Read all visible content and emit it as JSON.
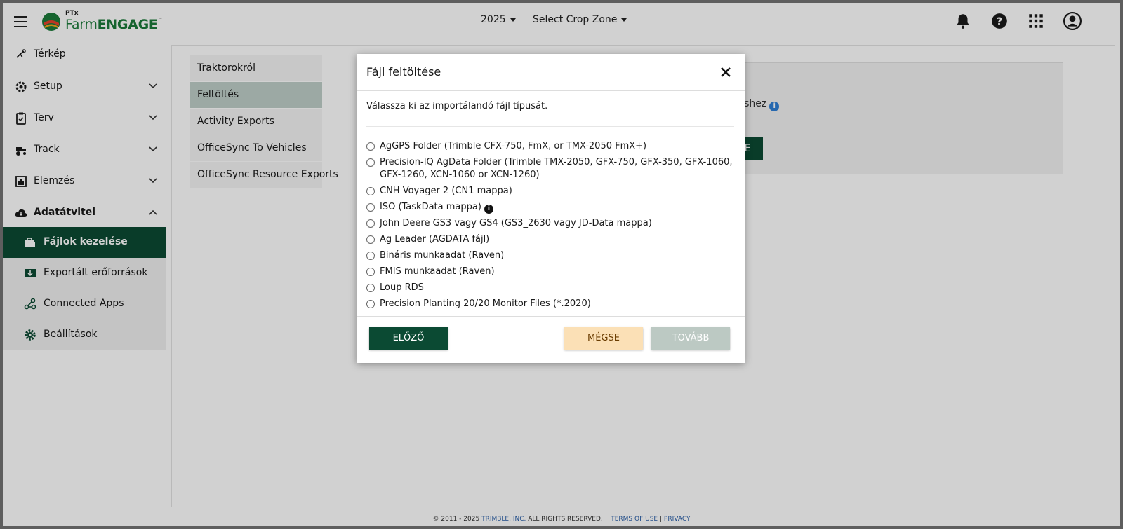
{
  "topbar": {
    "logo_ptx": "PTx",
    "logo_farm": "Farm",
    "logo_engage": "ENGAGE",
    "logo_tm": "™",
    "year": "2025",
    "crop_zone": "Select Crop Zone",
    "icons": [
      "bell-icon",
      "help-icon",
      "apps-grid-icon",
      "account-icon"
    ]
  },
  "sidebar": {
    "items": [
      {
        "label": "Térkép",
        "icon": "map-pin-icon"
      },
      {
        "label": "Setup",
        "icon": "gear-setup-icon"
      },
      {
        "label": "Terv",
        "icon": "clipboard-icon"
      },
      {
        "label": "Track",
        "icon": "tractor-icon"
      },
      {
        "label": "Elemzés",
        "icon": "analytics-icon"
      },
      {
        "label": "Adatátvitel",
        "icon": "cloud-download-icon"
      }
    ],
    "subitems": [
      {
        "label": "Fájlok kezelése",
        "icon": "files-icon"
      },
      {
        "label": "Exportált erőforrások",
        "icon": "export-icon"
      },
      {
        "label": "Connected Apps",
        "icon": "share-nodes-icon"
      },
      {
        "label": "Beállítások",
        "icon": "settings-icon"
      }
    ]
  },
  "content": {
    "tabs": [
      "Traktorokról",
      "Feltöltés",
      "Activity Exports",
      "OfficeSync To Vehicles",
      "OfficeSync Resource Exports"
    ],
    "panel_text": "téshez",
    "panel_button": "E"
  },
  "modal": {
    "title": "Fájl feltöltése",
    "intro": "Válassza ki az importálandó fájl típusát.",
    "options": [
      "AgGPS Folder (Trimble CFX-750, FmX, or TMX-2050 FmX+)",
      "Precision-IQ AgData Folder (Trimble TMX-2050, GFX-750, GFX-350, GFX-1060, GFX-1260, XCN-1060 or XCN-1260)",
      "CNH Voyager 2 (CN1 mappa)",
      "ISO (TaskData mappa)",
      "John Deere GS3 vagy GS4 (GS3_2630 vagy JD-Data mappa)",
      "Ag Leader (AGDATA fájl)",
      "Bináris munkaadat (Raven)",
      "FMIS munkaadat (Raven)",
      "Loup RDS",
      "Precision Planting 20/20 Monitor Files (*.2020)"
    ],
    "prev_label": "ELŐZŐ",
    "cancel_label": "MÉGSE",
    "next_label": "TOVÁBB"
  },
  "footer": {
    "copyright": "© 2011 - 2025",
    "company": "TRIMBLE, INC.",
    "rights": "ALL RIGHTS RESERVED.",
    "terms": "TERMS OF USE",
    "sep": "|",
    "privacy": "PRIVACY"
  },
  "colors": {
    "brand_green": "#0b4a33",
    "logo_green": "#1c7a3a",
    "cancel_bg": "#fbe0b6",
    "next_disabled_bg": "#bcc9c3",
    "info_blue": "#2f7fd6"
  }
}
